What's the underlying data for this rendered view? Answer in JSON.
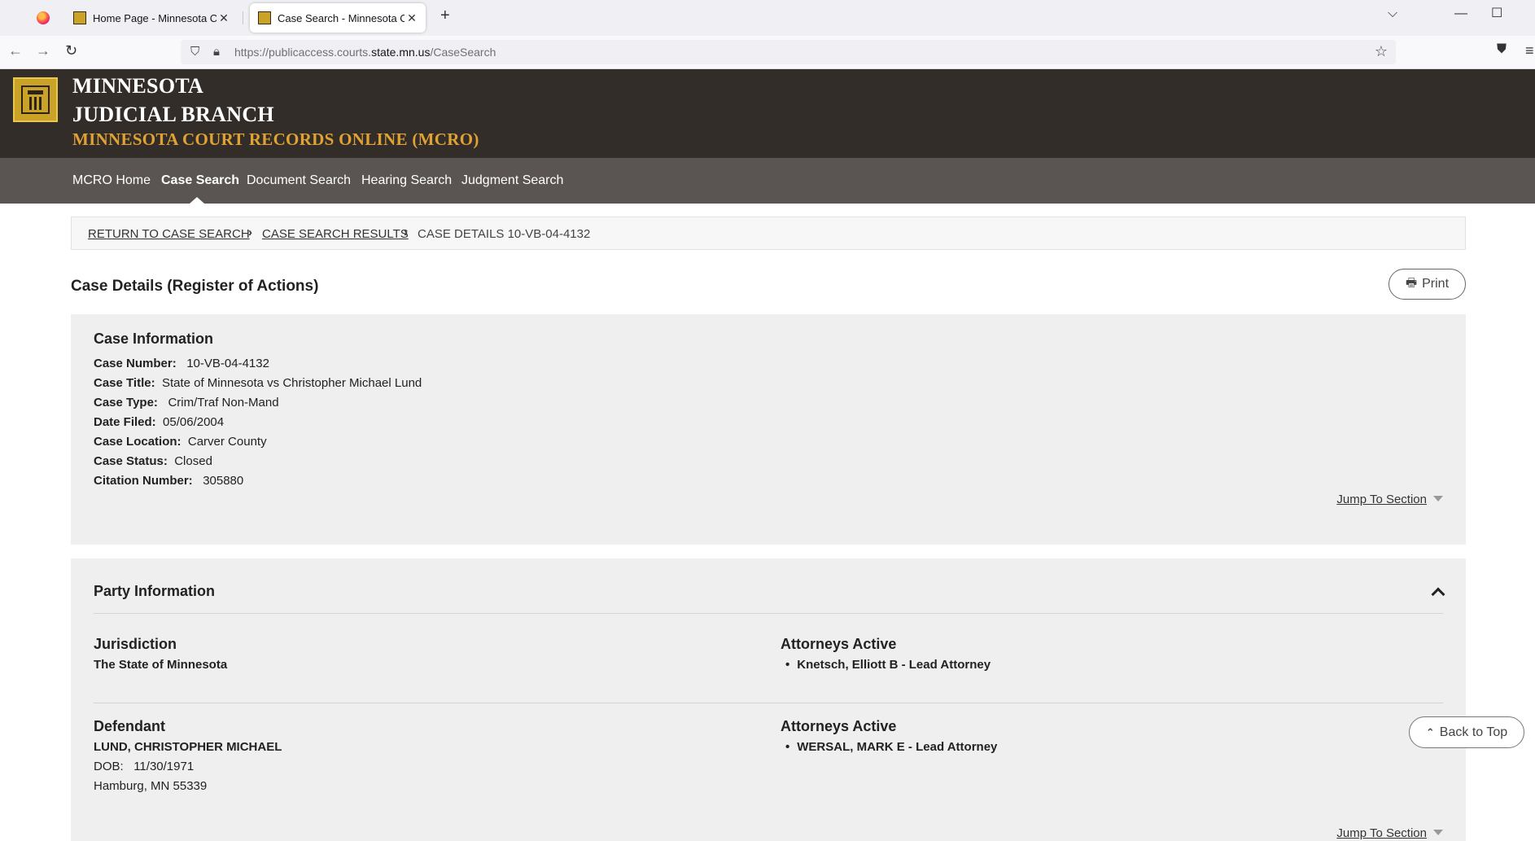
{
  "browser": {
    "tabs": [
      {
        "title": "Home Page - Minnesota Court R"
      },
      {
        "title": "Case Search - Minnesota Court"
      }
    ],
    "url_prefix": "https://publicaccess.courts.",
    "url_domain": "state.mn.us",
    "url_path": "/CaseSearch",
    "icons": {
      "back": "arrow-left-icon",
      "forward": "arrow-right-icon",
      "reload": "reload-icon",
      "shield": "shield-icon",
      "lock": "lock-icon",
      "bookmark": "star-icon",
      "pocket": "pocket-icon",
      "menu": "hamburger-icon",
      "tab_list": "chevron-down-icon",
      "new_tab": "plus-icon",
      "minimize": "minimize-icon",
      "maximize": "maximize-icon"
    }
  },
  "site": {
    "title_line1": "MINNESOTA",
    "title_line2": "JUDICIAL BRANCH",
    "subtitle": "MINNESOTA COURT RECORDS ONLINE (MCRO)",
    "colors": {
      "header_bg": "#332d29",
      "nav_bg": "#5a5552",
      "accent": "#e0a235",
      "seal": "#c9a227"
    }
  },
  "nav": {
    "items": [
      "MCRO Home",
      "Case Search",
      "Document Search",
      "Hearing Search",
      "Judgment Search"
    ],
    "active": "Case Search"
  },
  "breadcrumb": {
    "return": "RETURN TO CASE SEARCH",
    "results": "CASE SEARCH RESULTS",
    "current": "CASE DETAILS 10-VB-04-4132"
  },
  "page": {
    "title": "Case Details (Register of Actions)",
    "print_label": "Print"
  },
  "case_info": {
    "heading": "Case Information",
    "fields": [
      {
        "label": "Case Number:",
        "value": "10-VB-04-4132"
      },
      {
        "label": "Case Title:",
        "value": "State of Minnesota vs Christopher Michael Lund"
      },
      {
        "label": "Case Type:",
        "value": "Crim/Traf Non-Mand"
      },
      {
        "label": "Date Filed:",
        "value": "05/06/2004"
      },
      {
        "label": "Case Location:",
        "value": "Carver County"
      },
      {
        "label": "Case Status:",
        "value": "Closed"
      },
      {
        "label": "Citation Number:",
        "value": "305880"
      }
    ],
    "jump_label": "Jump To Section"
  },
  "party_info": {
    "heading": "Party Information",
    "parties": [
      {
        "role": "Jurisdiction",
        "name": "The State of Minnesota",
        "attorneys_heading": "Attorneys Active",
        "attorneys": [
          "Knetsch, Elliott B - Lead Attorney"
        ]
      },
      {
        "role": "Defendant",
        "name": "LUND, CHRISTOPHER MICHAEL",
        "dob_label": "DOB:",
        "dob": "11/30/1971",
        "address": "Hamburg, MN 55339",
        "attorneys_heading": "Attorneys Active",
        "attorneys": [
          "WERSAL, MARK E - Lead Attorney"
        ]
      }
    ],
    "jump_label": "Jump To Section"
  },
  "back_to_top_label": "Back to Top"
}
